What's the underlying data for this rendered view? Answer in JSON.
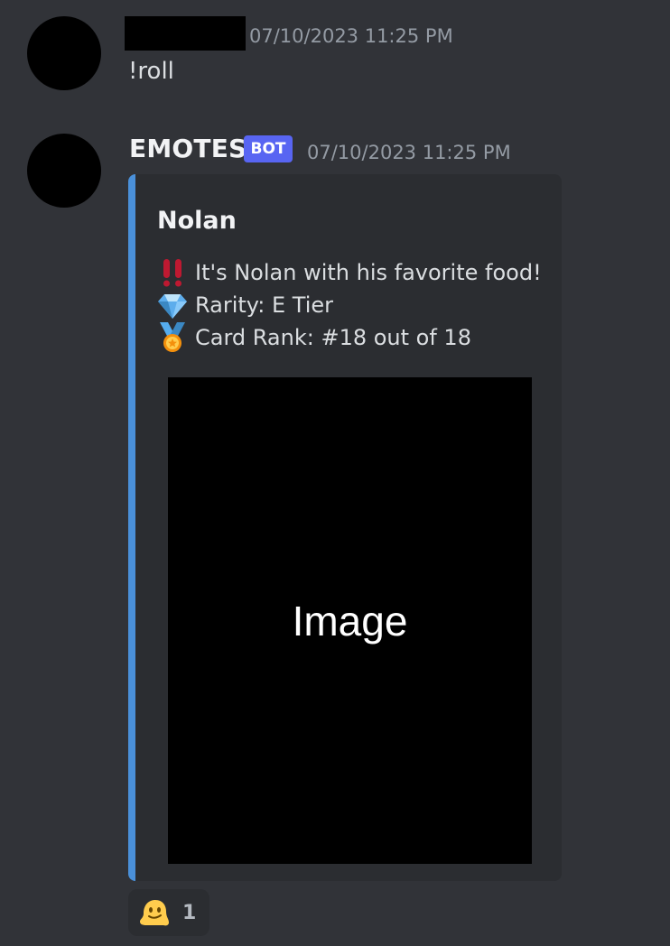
{
  "messages": [
    {
      "author": "",
      "timestamp": "07/10/2023 11:25 PM",
      "content": "!roll"
    },
    {
      "author": "EMOTES",
      "badge": "BOT",
      "timestamp": "07/10/2023 11:25 PM",
      "embed": {
        "accent_color": "#4a90d9",
        "title": "Nolan",
        "lines": [
          {
            "icon": "double-exclamation-icon",
            "text": "It's Nolan with his favorite food!"
          },
          {
            "icon": "gem-icon",
            "text": "Rarity: E Tier"
          },
          {
            "icon": "medal-icon",
            "text": "Card Rank: #18 out of 18"
          }
        ],
        "image_label": "Image"
      },
      "reactions": [
        {
          "icon": "melting-face-icon",
          "count": "1"
        }
      ]
    }
  ]
}
